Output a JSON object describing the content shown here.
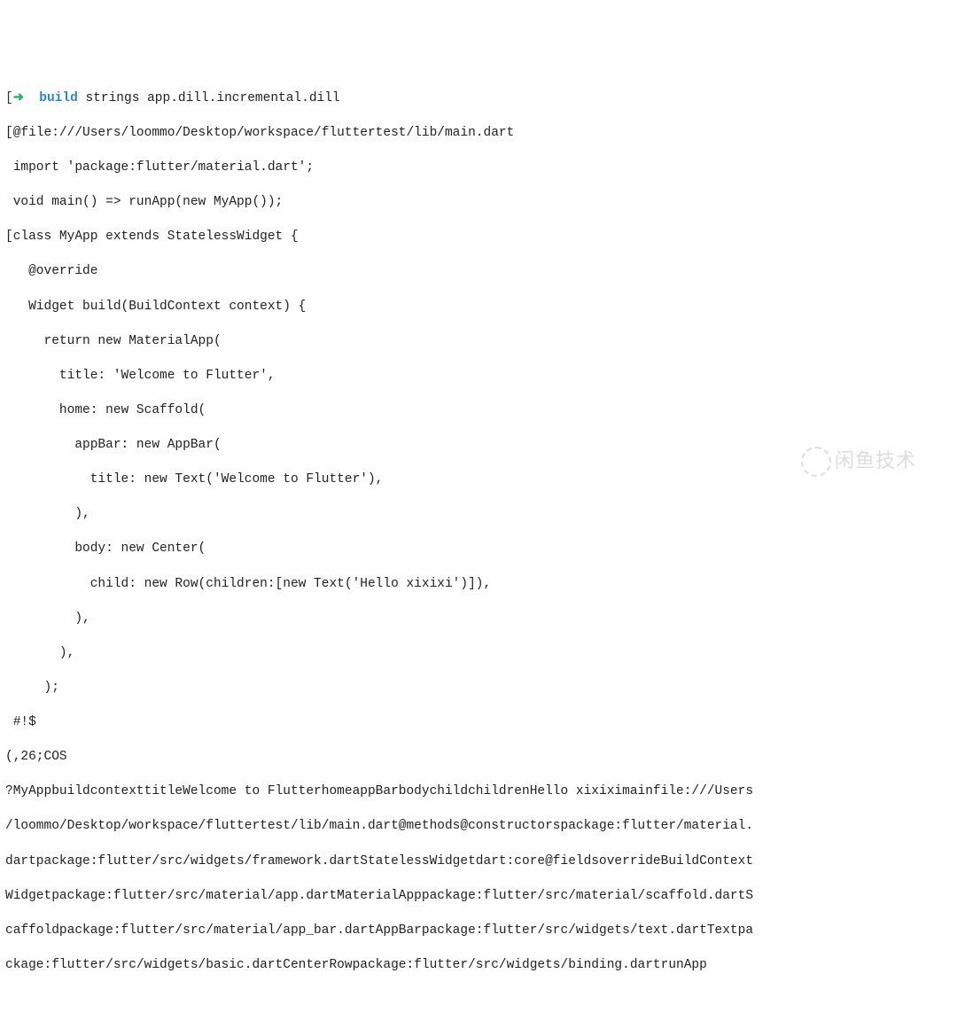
{
  "terminal": {
    "prompt": {
      "bracket_open": "[",
      "arrow": "➜",
      "command": "build",
      "args": "strings app.dill.incremental.dill"
    },
    "lines": {
      "l1": "[@file:///Users/loommo/Desktop/workspace/fluttertest/lib/main.dart",
      "l2": " import 'package:flutter/material.dart';",
      "l3": " void main() => runApp(new MyApp());",
      "l4": "[class MyApp extends StatelessWidget {",
      "l5": "   @override",
      "l6": "   Widget build(BuildContext context) {",
      "l7": "     return new MaterialApp(",
      "l8": "       title: 'Welcome to Flutter',",
      "l9": "       home: new Scaffold(",
      "l10": "         appBar: new AppBar(",
      "l11": "           title: new Text('Welcome to Flutter'),",
      "l12": "         ),",
      "l13": "         body: new Center(",
      "l14": "           child: new Row(children:[new Text('Hello xixixi')]),",
      "l15": "         ),",
      "l16": "       ),",
      "l17": "     );",
      "l18": " #!$",
      "l19": "(,26;COS",
      "l20": "?MyAppbuildcontexttitleWelcome to FlutterhomeappBarbodychildchildrenHello xixiximainfile:///Users",
      "l21": "/loommo/Desktop/workspace/fluttertest/lib/main.dart@methods@constructorspackage:flutter/material.",
      "l22": "dartpackage:flutter/src/widgets/framework.dartStatelessWidgetdart:core@fieldsoverrideBuildContext",
      "l23": "Widgetpackage:flutter/src/material/app.dartMaterialApppackage:flutter/src/material/scaffold.dartS",
      "l24": "caffoldpackage:flutter/src/material/app_bar.dartAppBarpackage:flutter/src/widgets/text.dartTextpa",
      "l25": "ckage:flutter/src/widgets/basic.dartCenterRowpackage:flutter/src/widgets/binding.dartrunApp"
    }
  },
  "watermark": {
    "text": "闲鱼技术"
  }
}
